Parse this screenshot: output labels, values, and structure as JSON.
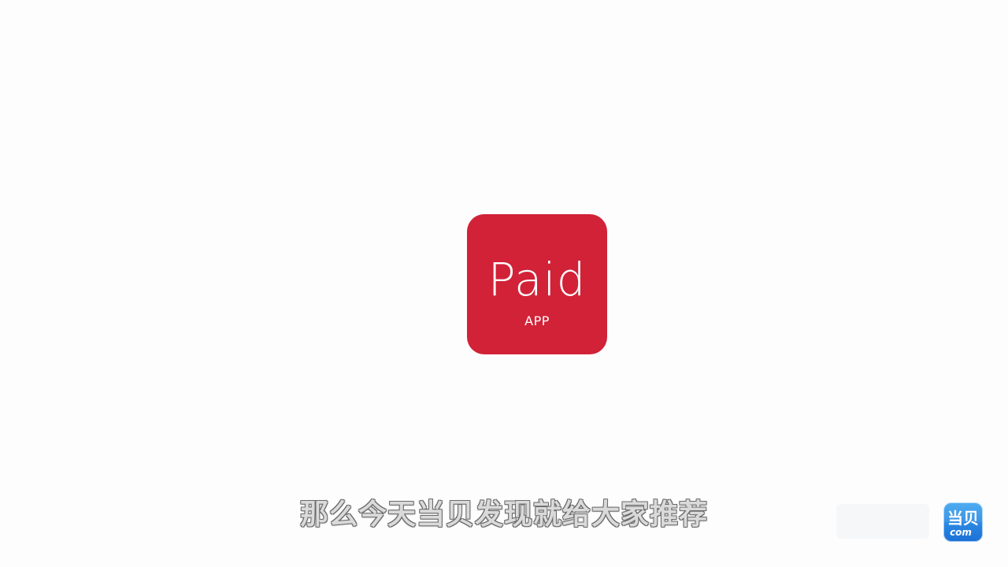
{
  "app_icon": {
    "name": "Paid",
    "label": "APP",
    "color": "#d12238"
  },
  "subtitle": {
    "text": "那么今天当贝发现就给大家推荐"
  },
  "brand_logo": {
    "text": "当贝",
    "domain": "com",
    "color": "#1b6fd6"
  }
}
